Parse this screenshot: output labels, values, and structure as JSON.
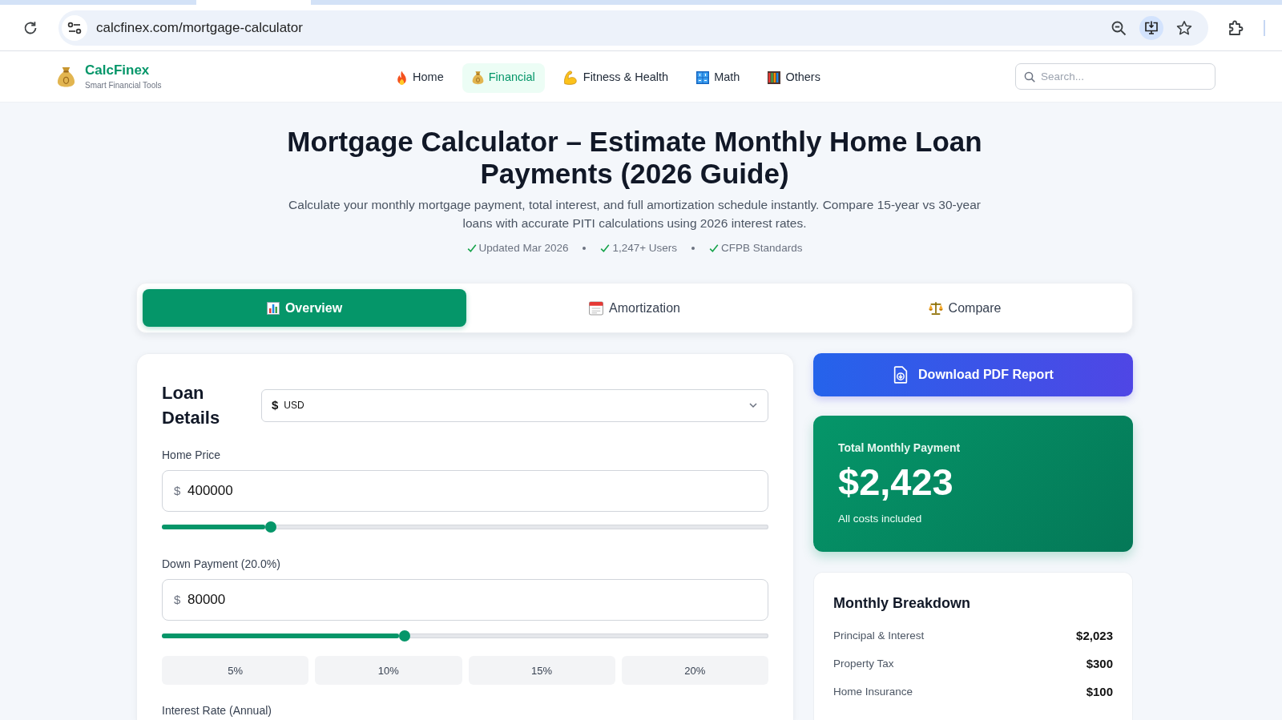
{
  "browser": {
    "url": "calcfinex.com/mortgage-calculator"
  },
  "header": {
    "brand": "CalcFinex",
    "tagline": "Smart Financial Tools",
    "nav": [
      {
        "label": "Home",
        "selected": false
      },
      {
        "label": "Financial",
        "selected": true
      },
      {
        "label": "Fitness & Health",
        "selected": false
      },
      {
        "label": "Math",
        "selected": false
      },
      {
        "label": "Others",
        "selected": false
      }
    ],
    "search": {
      "placeholder": "Search..."
    }
  },
  "hero": {
    "title": "Mortgage Calculator – Estimate Monthly Home Loan Payments (2026 Guide)",
    "subtitle": "Calculate your monthly mortgage payment, total interest, and full amortization schedule instantly. Compare 15-year vs 30-year loans with accurate PITI calculations using 2026 interest rates.",
    "highlights": [
      "Updated Mar 2026",
      "1,247+ Users",
      "CFPB Standards"
    ]
  },
  "tabs": [
    {
      "label": "Overview",
      "selected": true
    },
    {
      "label": "Amortization",
      "selected": false
    },
    {
      "label": "Compare",
      "selected": false
    }
  ],
  "loan_details": {
    "title": "Loan Details",
    "currency": {
      "symbol": "$",
      "value": "USD"
    },
    "fields": [
      {
        "label": "Home Price",
        "prefix": "$",
        "value": "400000",
        "level": 0.18
      },
      {
        "label": "Down Payment (20.0%)",
        "prefix": "$",
        "value": "80000",
        "level": 0.4,
        "presets": [
          {
            "label": "5%",
            "selected": false
          },
          {
            "label": "10%",
            "selected": false
          },
          {
            "label": "15%",
            "selected": false
          },
          {
            "label": "20%",
            "selected": false
          }
        ]
      }
    ],
    "interest_rate": {
      "label": "Interest Rate (Annual)"
    }
  },
  "download_button": {
    "label": "Download PDF Report"
  },
  "total": {
    "label": "Total Monthly Payment",
    "amount": "$2,423",
    "note": "All costs included"
  },
  "breakdown": {
    "title": "Monthly Breakdown",
    "rows": [
      {
        "label": "Principal & Interest",
        "value": "$2,023"
      },
      {
        "label": "Property Tax",
        "value": "$300"
      },
      {
        "label": "Home Insurance",
        "value": "$100"
      }
    ]
  }
}
